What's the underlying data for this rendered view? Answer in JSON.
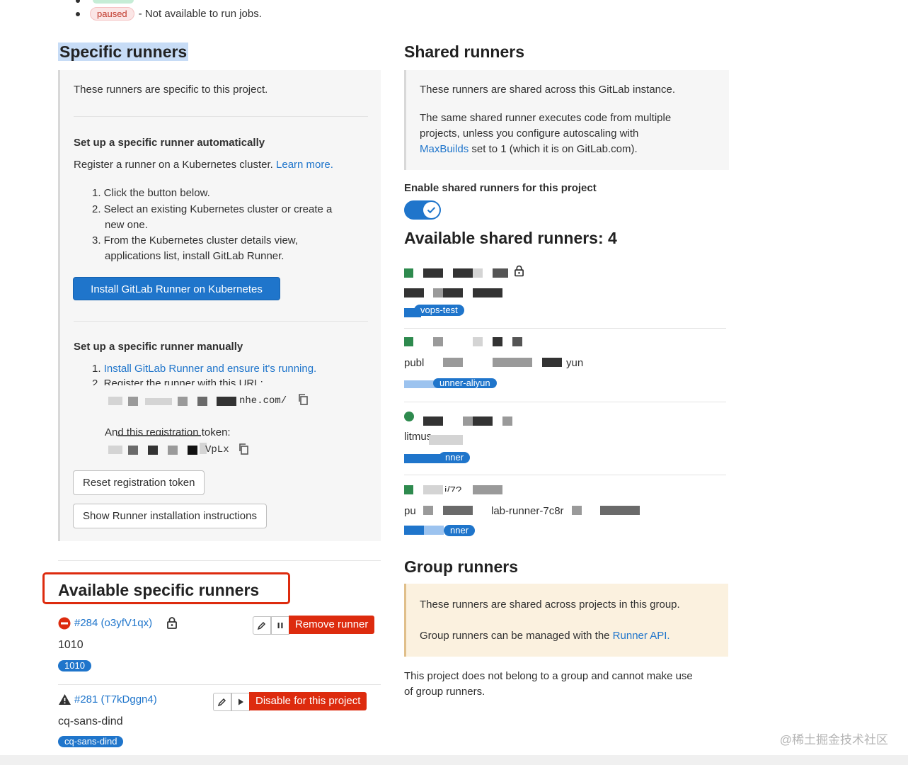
{
  "legend": {
    "paused_label": "paused",
    "paused_text": "- Not available to run jobs."
  },
  "specific": {
    "title": "Specific runners",
    "intro": "These runners are specific to this project.",
    "auto_heading": "Set up a specific runner automatically",
    "auto_desc": "Register a runner on a Kubernetes cluster.",
    "learn_more": "Learn more.",
    "steps": [
      "1. Click the button below.",
      "2. Select an existing Kubernetes cluster or create a",
      "new one.",
      "3. From the Kubernetes cluster details view,",
      "applications list, install GitLab Runner."
    ],
    "install_button": "Install GitLab Runner on Kubernetes",
    "manual_heading": "Set up a specific runner manually",
    "manual_step1": "Install GitLab Runner and ensure it's running.",
    "manual_step1_prefix": "1.",
    "manual_step2": "2. Register the runner with this URL:",
    "url_suffix": "nhe.com/",
    "token_label": "And this registration token:",
    "token_suffix": "VpLx",
    "reset_button": "Reset registration token",
    "show_button": "Show Runner installation instructions"
  },
  "available_specific": {
    "title": "Available specific runners",
    "runners": [
      {
        "id": "#284 (o3yfV1qx)",
        "description": "1010",
        "tag": "1010",
        "action": "Remove runner",
        "status_icon": "paused-icon",
        "lock_icon": "lock-icon"
      },
      {
        "id": "#281 (T7kDggn4)",
        "description": "cq-sans-dind",
        "tag": "cq-sans-dind",
        "action": "Disable for this project",
        "status_icon": "warning-icon"
      }
    ]
  },
  "shared": {
    "title": "Shared runners",
    "desc1": "These runners are shared across this GitLab instance.",
    "desc2_line1": "The same shared runner executes code from multiple",
    "desc2_line2": "projects, unless you configure autoscaling with",
    "maxbuilds": "MaxBuilds",
    "desc2_tail": "set to 1 (which it is on GitLab.com).",
    "enable_label": "Enable shared runners for this project",
    "enabled": true,
    "available_title": "Available shared runners: 4",
    "runners": [
      {
        "tag": "vops-test"
      },
      {
        "desc_start": "publ",
        "desc_end": "yun",
        "tag": "unner-aliyun"
      },
      {
        "desc_start": "litmus",
        "tag": "nner"
      },
      {
        "name_frag": "i/7?",
        "desc_start": "pu",
        "desc_mid": "lab-runner-7c8r",
        "tag": "nner"
      }
    ]
  },
  "group": {
    "title": "Group runners",
    "desc1": "These runners are shared across projects in this group.",
    "desc2_prefix": "Group runners can be managed with the",
    "runner_api": "Runner API.",
    "note_line1": "This project does not belong to a group and cannot make use",
    "note_line2": "of group runners."
  },
  "watermark": "@稀土掘金技术社区",
  "colors": {
    "primary": "#1f75cb",
    "danger": "#dd2b0e",
    "success": "#2e8a4e",
    "highlight": "#c7dcf6",
    "group_panel": "#fbf1df"
  }
}
